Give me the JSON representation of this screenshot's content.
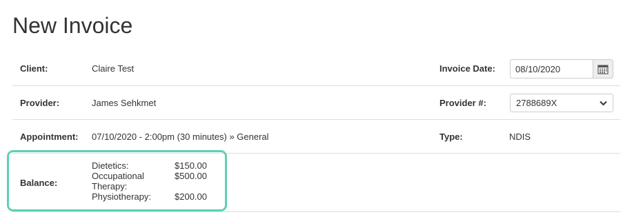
{
  "page": {
    "title": "New Invoice"
  },
  "form": {
    "client_label": "Client:",
    "client_value": "Claire Test",
    "invoice_date_label": "Invoice Date:",
    "invoice_date_value": "08/10/2020",
    "provider_label": "Provider:",
    "provider_value": "James Sehkmet",
    "provider_num_label": "Provider #:",
    "provider_num_selected": "2788689X",
    "appointment_label": "Appointment:",
    "appointment_value": "07/10/2020 - 2:00pm (30 minutes) » General",
    "type_label": "Type:",
    "type_value": "NDIS",
    "balance_label": "Balance:"
  },
  "balance": [
    {
      "name": "Dietetics:",
      "amount": "$150.00"
    },
    {
      "name": "Occupational Therapy:",
      "amount": "$500.00"
    },
    {
      "name": "Physiotherapy:",
      "amount": "$200.00"
    }
  ],
  "icons": {
    "calendar": "calendar-icon",
    "dropdown": "chevron-down-icon"
  },
  "colors": {
    "highlight": "#5cd1b4",
    "border": "#dddddd"
  }
}
